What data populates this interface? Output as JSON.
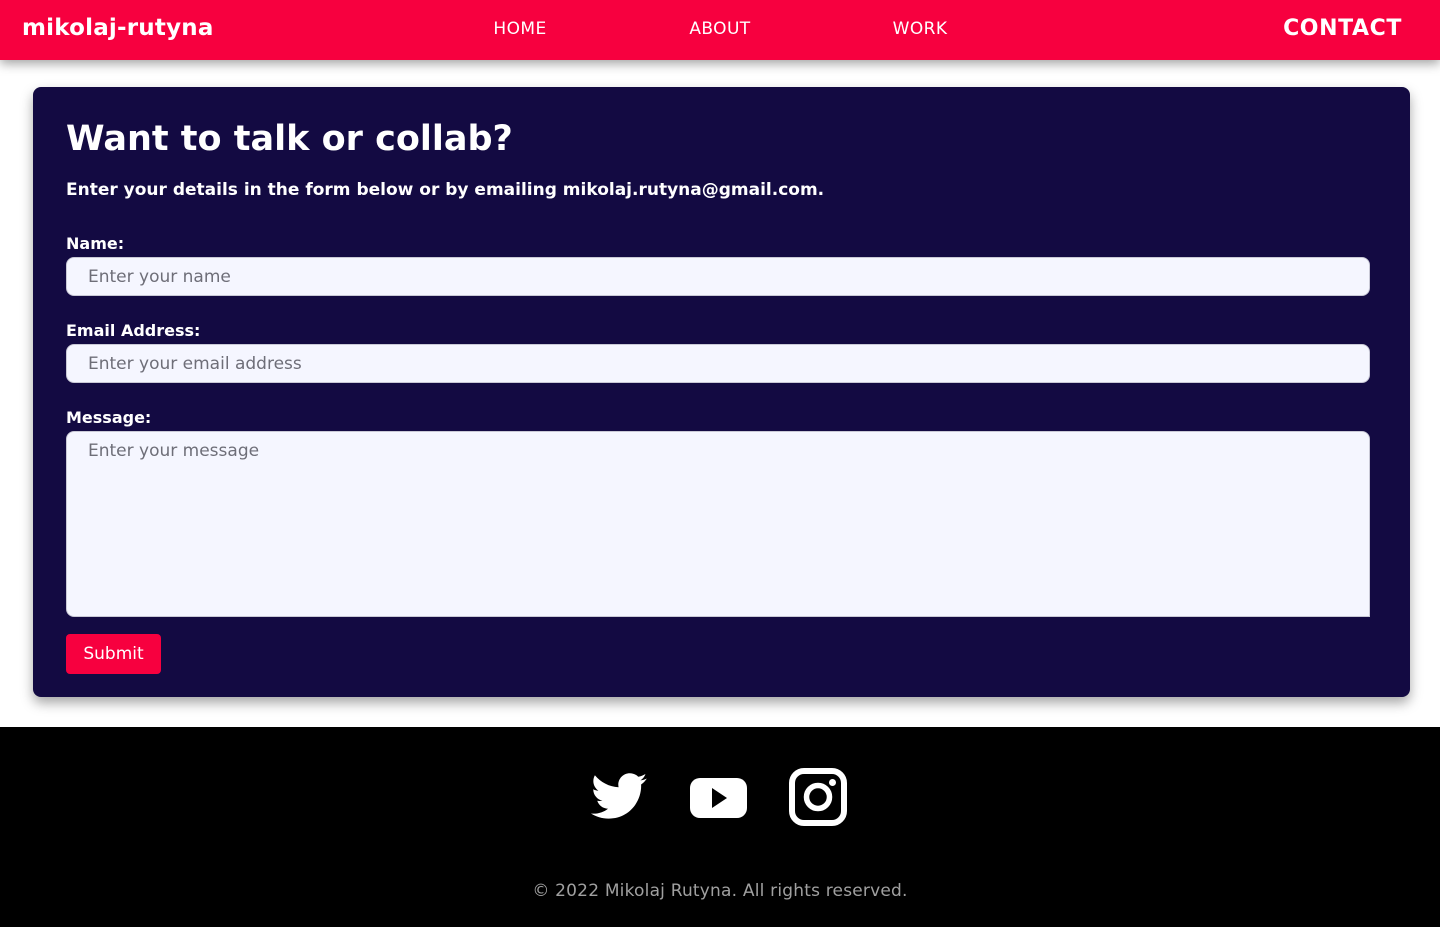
{
  "header": {
    "logo": "mikolaj-rutyna",
    "nav": {
      "home": "HOME",
      "about": "ABOUT",
      "work": "WORK",
      "contact": "CONTACT"
    }
  },
  "contact_form": {
    "title": "Want to talk or collab?",
    "subtitle": "Enter your details in the form below or by emailing mikolaj.rutyna@gmail.com.",
    "name": {
      "label": "Name:",
      "placeholder": "Enter your name",
      "value": ""
    },
    "email": {
      "label": "Email Address:",
      "placeholder": "Enter your email address",
      "value": ""
    },
    "message": {
      "label": "Message:",
      "placeholder": "Enter your message",
      "value": ""
    },
    "submit_label": "Submit"
  },
  "footer": {
    "social": [
      {
        "icon": "twitter-icon"
      },
      {
        "icon": "youtube-icon"
      },
      {
        "icon": "instagram-icon"
      }
    ],
    "copyright": "© 2022 Mikolaj Rutyna. All rights reserved."
  },
  "colors": {
    "accent": "#f7003f",
    "card_background": "#130a42",
    "footer_background": "#000000",
    "input_background": "#f5f6ff",
    "text_light": "#ffffff",
    "footer_text": "#a0a0a0"
  }
}
